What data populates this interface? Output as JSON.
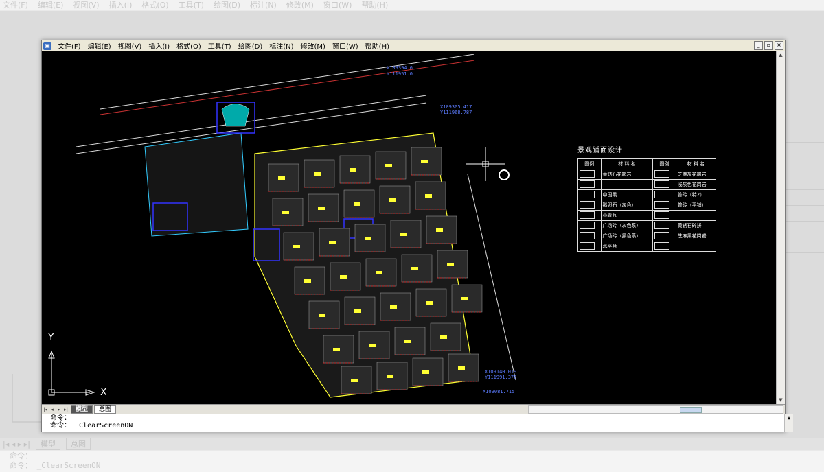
{
  "menu": {
    "items": [
      "文件(F)",
      "编辑(E)",
      "视图(V)",
      "插入(I)",
      "格式(O)",
      "工具(T)",
      "绘图(D)",
      "标注(N)",
      "修改(M)",
      "窗口(W)",
      "帮助(H)"
    ]
  },
  "window_controls": {
    "minimize": "_",
    "restore": "▫",
    "close": "×"
  },
  "coords": {
    "c1a": "X109394.6",
    "c1b": "Y111951.0",
    "c2a": "X109305.417",
    "c2b": "Y111968.787",
    "c3a": "X109140.019",
    "c3b": "Y111991.376",
    "c4": "X109081.715"
  },
  "legend": {
    "title": "景观铺面设计",
    "header": [
      "图例",
      "材 料 名",
      "图例",
      "材 料 名"
    ],
    "left_items": [
      "黄锈石花岗岩",
      "",
      "中国黑",
      "鹅卵石（灰色）",
      "小青瓦",
      "广场砖（灰色系）",
      "广场砖（黑色系）",
      "水平台"
    ],
    "right_items": [
      "芝麻灰花岗岩",
      "浅灰色花岗岩",
      "普砖（特2）",
      "普砖（平铺）",
      "",
      "黄锈石碎拼",
      "芝麻黑花岗岩",
      ""
    ]
  },
  "axis": {
    "x": "X",
    "y": "Y"
  },
  "tabs": {
    "model": "模型",
    "layout": "总图"
  },
  "command": {
    "line1": "命令：",
    "line2": "命令： _ClearScreenON"
  },
  "background": {
    "menu": [
      "文件(F)",
      "编辑(E)",
      "视图(V)",
      "插入(I)",
      "格式(O)",
      "工具(T)",
      "绘图(D)",
      "标注(N)",
      "修改(M)",
      "窗口(W)",
      "帮助(H)"
    ],
    "model_tab": "模型",
    "layout_tab": "总图",
    "cmd_line1": "命令：",
    "cmd_line2": "命令： _ClearScreenON"
  }
}
